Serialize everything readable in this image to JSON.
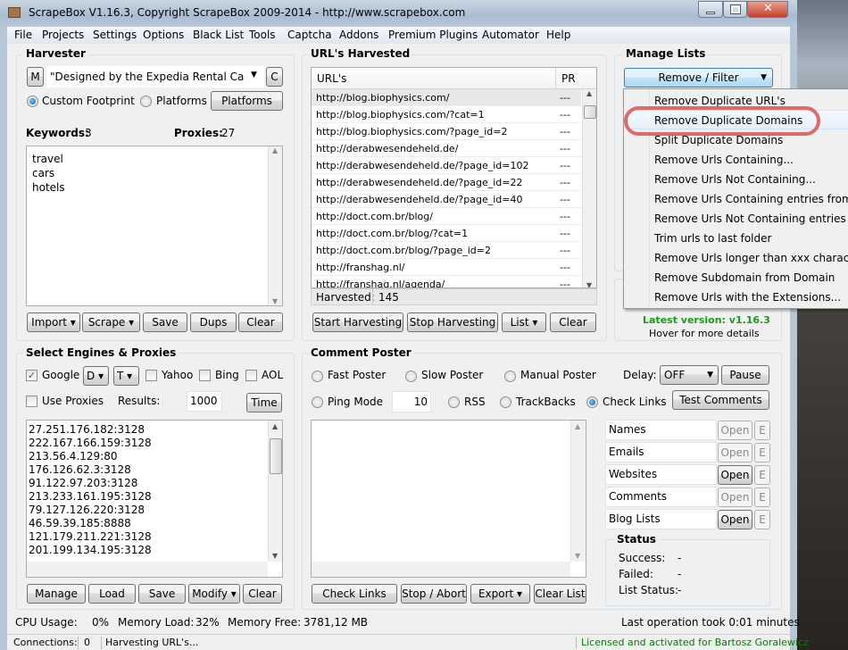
{
  "window": {
    "title": "ScrapeBox V1.16.3, Copyright ScrapeBox 2009-2014 - http://www.scrapebox.com"
  },
  "menu": [
    "File",
    "Projects",
    "Settings",
    "Options",
    "Black List",
    "Tools",
    "Captcha",
    "Addons",
    "Premium Plugins",
    "Automator",
    "Help"
  ],
  "harvester": {
    "title": "Harvester",
    "m_label": "M",
    "footprint": "\"Designed by the Expedia Rental Cars Te",
    "c_label": "C",
    "custom_footprint": "Custom Footprint",
    "platforms_radio": "Platforms",
    "platforms_button": "Platforms",
    "keywords_label": "Keywords:",
    "keywords_count": "3",
    "proxies_label": "Proxies:",
    "proxies_count": "27",
    "keywords": [
      "travel",
      "cars",
      "hotels"
    ],
    "buttons": {
      "import": "Import",
      "scrape": "Scrape",
      "save": "Save",
      "dups": "Dups",
      "clear": "Clear"
    }
  },
  "urls": {
    "title": "URL's Harvested",
    "col_url": "URL's",
    "col_pr": "PR",
    "rows": [
      {
        "url": "http://blog.biophysics.com/",
        "pr": "---"
      },
      {
        "url": "http://blog.biophysics.com/?cat=1",
        "pr": "---"
      },
      {
        "url": "http://blog.biophysics.com/?page_id=2",
        "pr": "---"
      },
      {
        "url": "http://derabwesendeheld.de/",
        "pr": "---"
      },
      {
        "url": "http://derabwesendeheld.de/?page_id=102",
        "pr": "---"
      },
      {
        "url": "http://derabwesendeheld.de/?page_id=22",
        "pr": "---"
      },
      {
        "url": "http://derabwesendeheld.de/?page_id=40",
        "pr": "---"
      },
      {
        "url": "http://doct.com.br/blog/",
        "pr": "---"
      },
      {
        "url": "http://doct.com.br/blog/?cat=1",
        "pr": "---"
      },
      {
        "url": "http://doct.com.br/blog/?page_id=2",
        "pr": "---"
      },
      {
        "url": "http://franshag.nl/",
        "pr": "---"
      },
      {
        "url": "http://franshag.nl/agenda/",
        "pr": "---"
      }
    ],
    "harvested_label": "Harvested:",
    "harvested_count": "145",
    "buttons": {
      "start": "Start Harvesting",
      "stop": "Stop Harvesting",
      "list": "List",
      "clear": "Clear"
    }
  },
  "manage": {
    "title": "Manage Lists",
    "dropdown": "Remove / Filter",
    "latest_version": "Latest version: v1.16.3",
    "hover": "Hover for more details",
    "menu_items": [
      "Remove Duplicate URL's",
      "Remove Duplicate Domains",
      "Split Duplicate Domains",
      "Remove Urls Containing...",
      "Remove Urls Not Containing...",
      "Remove Urls Containing entries from...",
      "Remove Urls Not Containing entries from...",
      "Trim urls to last folder",
      "Remove Urls longer than xxx character",
      "Remove Subdomain from Domain",
      "Remove Urls with the Extensions..."
    ],
    "highlighted_index": 1
  },
  "engines": {
    "title": "Select Engines & Proxies",
    "google": "Google",
    "google_checked": true,
    "d_label": "D",
    "t_label": "T",
    "yahoo": "Yahoo",
    "bing": "Bing",
    "aol": "AOL",
    "use_proxies": "Use Proxies",
    "results_label": "Results:",
    "results_value": "1000",
    "time_button": "Time",
    "proxies": [
      "27.251.176.182:3128",
      "222.167.166.159:3128",
      "213.56.4.129:80",
      "176.126.62.3:3128",
      "91.122.97.203:3128",
      "213.233.161.195:3128",
      "79.127.126.220:3128",
      "46.59.39.185:8888",
      "121.179.211.221:3128",
      "201.199.134.195:3128"
    ],
    "buttons": {
      "manage": "Manage",
      "load": "Load",
      "save": "Save",
      "modify": "Modify",
      "clear": "Clear"
    }
  },
  "poster": {
    "title": "Comment Poster",
    "fast": "Fast Poster",
    "slow": "Slow Poster",
    "manual": "Manual Poster",
    "delay_label": "Delay:",
    "delay_value": "OFF",
    "pause": "Pause",
    "ping": "Ping Mode",
    "ping_value": "10",
    "rss": "RSS",
    "trackbacks": "TrackBacks",
    "check_links": "Check Links",
    "test_comments": "Test Comments",
    "lists": [
      {
        "name": "Names",
        "open": "Open",
        "enabled": false,
        "e": "E"
      },
      {
        "name": "Emails",
        "open": "Open",
        "enabled": false,
        "e": "E"
      },
      {
        "name": "Websites",
        "open": "Open",
        "enabled": true,
        "e": "E"
      },
      {
        "name": "Comments",
        "open": "Open",
        "enabled": false,
        "e": "E"
      },
      {
        "name": "Blog Lists",
        "open": "Open",
        "enabled": true,
        "e": "E"
      }
    ],
    "status": {
      "title": "Status",
      "success_label": "Success:",
      "success": "-",
      "failed_label": "Failed:",
      "failed": "-",
      "list_label": "List Status:",
      "list": "-"
    },
    "buttons": {
      "check": "Check Links",
      "stop": "Stop / Abort",
      "export": "Export",
      "clear": "Clear List"
    }
  },
  "sysinfo": {
    "cpu_label": "CPU Usage:",
    "cpu": "0%",
    "mem_label": "Memory Load:",
    "mem": "32%",
    "free_label": "Memory Free:",
    "free": "3781,12 MB",
    "last_op": "Last operation took 0:01 minutes"
  },
  "statusbar": {
    "connections_label": "Connections:",
    "connections": "0",
    "activity": "Harvesting URL's...",
    "license": "Licensed and activated for Bartosz Goralewicz",
    "license_color": "#008000"
  }
}
